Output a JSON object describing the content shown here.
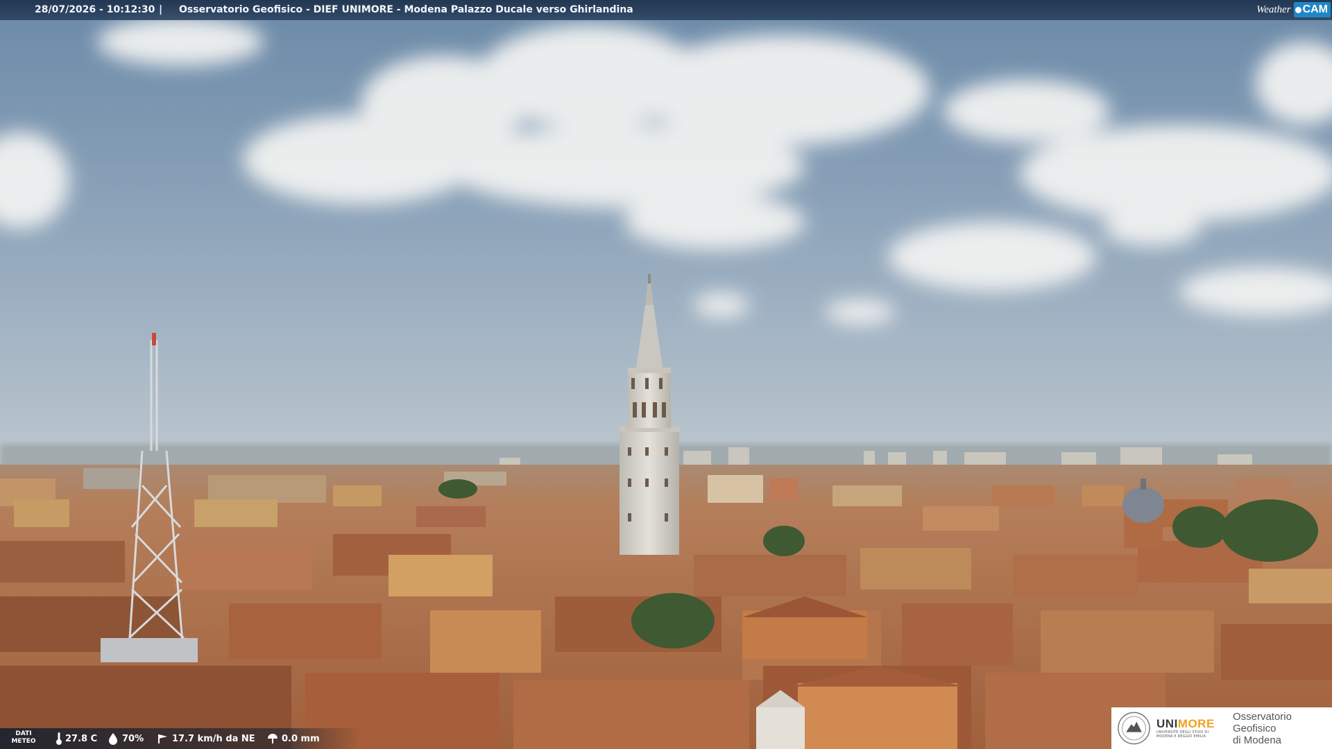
{
  "overlay": {
    "timestamp": "28/07/2026 - 10:12:30",
    "separator": "|",
    "location": "Osservatorio Geofisico - DIEF UNIMORE - Modena Palazzo Ducale verso Ghirlandina",
    "brand_left": "Weather",
    "brand_right": "CAM"
  },
  "meteo": {
    "label": "DATI METEO",
    "temperature": "27.8 C",
    "humidity": "70%",
    "wind": "17.7 km/h da NE",
    "rain": "0.0 mm",
    "icons": [
      "thermometer-icon",
      "humidity-icon",
      "wind-icon",
      "rain-icon"
    ]
  },
  "logo": {
    "wordmark_uni": "UNI",
    "wordmark_more": "MORE",
    "subline": "UNIVERSITÀ DEGLI STUDI DI MODENA E REGGIO EMILIA",
    "obs_line1": "Osservatorio Geofisico",
    "obs_line2": "di Modena"
  },
  "colors": {
    "sky_top": "#6d8ba8",
    "sky_bottom": "#b4c1cb",
    "roof": "#b9724a",
    "tower": "#d9d6cf",
    "bar": "#1c304a",
    "accent": "#f0a21b",
    "cam_blue": "#1f86c8"
  }
}
